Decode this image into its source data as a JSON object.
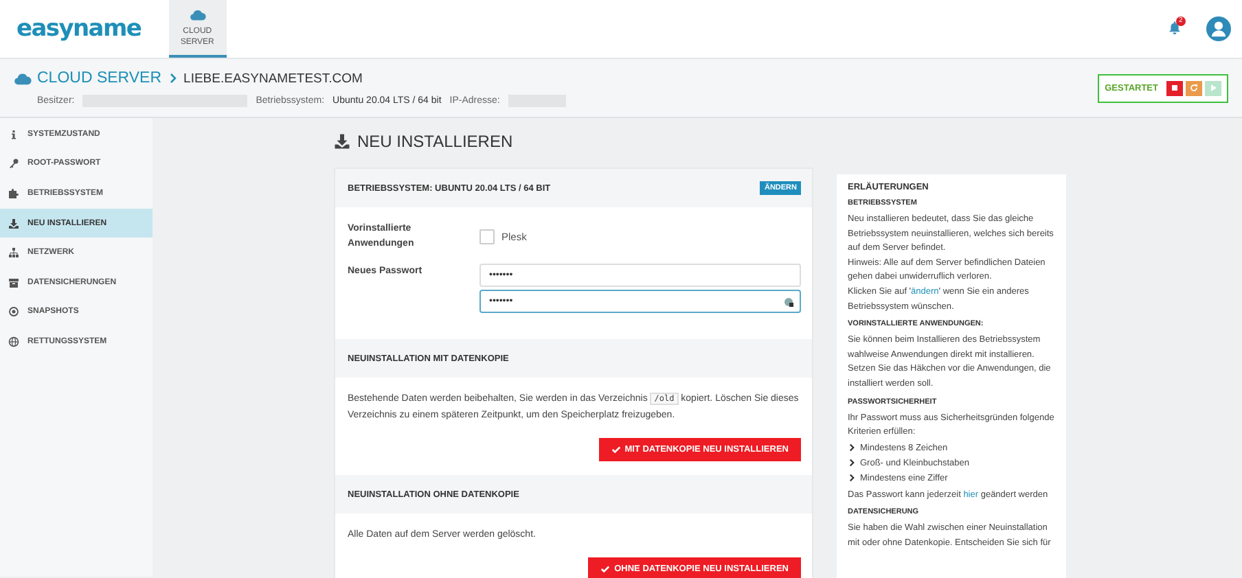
{
  "header": {
    "logo": "easyname",
    "nav": [
      {
        "label": "CLOUD SERVER",
        "selected": true
      }
    ],
    "notification_count": "2"
  },
  "server": {
    "section": "CLOUD SERVER",
    "name": "LIEBE.EASYNAMETEST.COM",
    "owner_label": "Besitzer:",
    "os_label": "Betriebssystem:",
    "os_value": "Ubuntu 20.04 LTS / 64 bit",
    "ip_label": "IP-Adresse:",
    "status": "GESTARTET",
    "power_buttons": [
      {
        "kind": "stop",
        "disabled": false
      },
      {
        "kind": "restart",
        "disabled": false
      },
      {
        "kind": "start",
        "disabled": true
      }
    ]
  },
  "sidebar": {
    "items": [
      {
        "label": "SYSTEMZUSTAND",
        "selected": false
      },
      {
        "label": "ROOT-PASSWORT",
        "selected": false
      },
      {
        "label": "BETRIEBSSYSTEM",
        "selected": false
      },
      {
        "label": "NEU INSTALLIEREN",
        "selected": true
      },
      {
        "label": "NETZWERK",
        "selected": false
      },
      {
        "label": "DATENSICHERUNGEN",
        "selected": false
      },
      {
        "label": "SNAPSHOTS",
        "selected": false
      },
      {
        "label": "RETTUNGSSYSTEM",
        "selected": false
      }
    ]
  },
  "page_title": "NEU INSTALLIEREN",
  "os_card": {
    "heading": "BETRIEBSSYSTEM: UBUNTU 20.04 LTS / 64 BIT",
    "change_button": "ÄNDERN",
    "apps_label": "Vorinstallierte Anwendungen",
    "apps": [
      {
        "label": "Plesk",
        "checked": false
      }
    ],
    "password_label": "Neues Passwort",
    "password": "•••••••",
    "password_repeat": "•••••••"
  },
  "with_copy": {
    "heading": "NEUINSTALLATION MIT DATENKOPIE",
    "text_before": "Bestehende Daten werden beibehalten, Sie werden in das Verzeichnis",
    "code": "/old",
    "text_after": "kopiert. Löschen Sie dieses Verzeichnis zu einem späteren Zeitpunkt, um den Speicherplatz freizugeben.",
    "button": "MIT DATENKOPIE NEU INSTALLIEREN"
  },
  "without_copy": {
    "heading": "NEUINSTALLATION OHNE DATENKOPIE",
    "text": "Alle Daten auf dem Server werden gelöscht.",
    "button": "OHNE DATENKOPIE NEU INSTALLIEREN"
  },
  "help": {
    "title": "ERLÄUTERUNGEN",
    "sections": [
      {
        "heading": "BETRIEBSSYSTEM",
        "blocks": [
          {
            "kind": "text",
            "text": "Neu installieren bedeutet, dass Sie das gleiche Betriebssystem neuinstallieren, welches sich bereits auf dem Server befindet."
          },
          {
            "kind": "text",
            "text": "Hinweis: Alle auf dem Server befindlichen Dateien gehen dabei unwiderruflich verloren."
          },
          {
            "kind": "text",
            "text": "Klicken Sie auf '",
            "link": "ändern",
            "after": "' wenn Sie ein anderes Betriebssystem wünschen."
          }
        ]
      },
      {
        "heading": "VORINSTALLIERTE ANWENDUNGEN:",
        "blocks": [
          {
            "kind": "text",
            "text": "Sie können beim Installieren des Betriebssystem wahlweise Anwendungen direkt mit installieren. Setzen Sie das Häkchen vor die Anwendungen, die installiert werden soll."
          }
        ]
      },
      {
        "heading": "PASSWORTSICHERHEIT",
        "blocks": [
          {
            "kind": "text",
            "text": "Ihr Passwort muss aus Sicherheitsgründen folgende Kriterien erfüllen:"
          },
          {
            "kind": "bullet",
            "text": "Mindestens 8 Zeichen"
          },
          {
            "kind": "bullet",
            "text": "Groß- und Kleinbuchstaben"
          },
          {
            "kind": "bullet",
            "text": "Mindestens eine Ziffer"
          },
          {
            "kind": "text",
            "text": "Das Passwort kann jederzeit ",
            "link": "hier",
            "after": " geändert werden"
          }
        ]
      },
      {
        "heading": "DATENSICHERUNG",
        "blocks": [
          {
            "kind": "text",
            "text": "Sie haben die Wahl zwischen einer Neuinstallation mit oder ohne Datenkopie. Entscheiden Sie sich für"
          }
        ]
      }
    ]
  }
}
